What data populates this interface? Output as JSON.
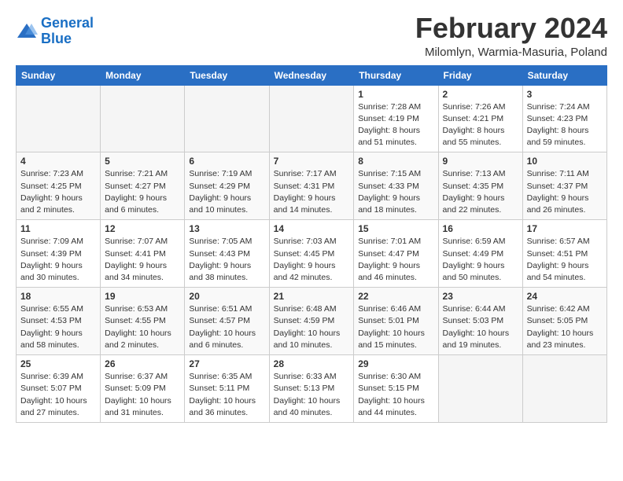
{
  "header": {
    "logo_line1": "General",
    "logo_line2": "Blue",
    "title": "February 2024",
    "subtitle": "Milomlyn, Warmia-Masuria, Poland"
  },
  "calendar": {
    "weekdays": [
      "Sunday",
      "Monday",
      "Tuesday",
      "Wednesday",
      "Thursday",
      "Friday",
      "Saturday"
    ],
    "rows": [
      [
        {
          "day": "",
          "info": ""
        },
        {
          "day": "",
          "info": ""
        },
        {
          "day": "",
          "info": ""
        },
        {
          "day": "",
          "info": ""
        },
        {
          "day": "1",
          "info": "Sunrise: 7:28 AM\nSunset: 4:19 PM\nDaylight: 8 hours\nand 51 minutes."
        },
        {
          "day": "2",
          "info": "Sunrise: 7:26 AM\nSunset: 4:21 PM\nDaylight: 8 hours\nand 55 minutes."
        },
        {
          "day": "3",
          "info": "Sunrise: 7:24 AM\nSunset: 4:23 PM\nDaylight: 8 hours\nand 59 minutes."
        }
      ],
      [
        {
          "day": "4",
          "info": "Sunrise: 7:23 AM\nSunset: 4:25 PM\nDaylight: 9 hours\nand 2 minutes."
        },
        {
          "day": "5",
          "info": "Sunrise: 7:21 AM\nSunset: 4:27 PM\nDaylight: 9 hours\nand 6 minutes."
        },
        {
          "day": "6",
          "info": "Sunrise: 7:19 AM\nSunset: 4:29 PM\nDaylight: 9 hours\nand 10 minutes."
        },
        {
          "day": "7",
          "info": "Sunrise: 7:17 AM\nSunset: 4:31 PM\nDaylight: 9 hours\nand 14 minutes."
        },
        {
          "day": "8",
          "info": "Sunrise: 7:15 AM\nSunset: 4:33 PM\nDaylight: 9 hours\nand 18 minutes."
        },
        {
          "day": "9",
          "info": "Sunrise: 7:13 AM\nSunset: 4:35 PM\nDaylight: 9 hours\nand 22 minutes."
        },
        {
          "day": "10",
          "info": "Sunrise: 7:11 AM\nSunset: 4:37 PM\nDaylight: 9 hours\nand 26 minutes."
        }
      ],
      [
        {
          "day": "11",
          "info": "Sunrise: 7:09 AM\nSunset: 4:39 PM\nDaylight: 9 hours\nand 30 minutes."
        },
        {
          "day": "12",
          "info": "Sunrise: 7:07 AM\nSunset: 4:41 PM\nDaylight: 9 hours\nand 34 minutes."
        },
        {
          "day": "13",
          "info": "Sunrise: 7:05 AM\nSunset: 4:43 PM\nDaylight: 9 hours\nand 38 minutes."
        },
        {
          "day": "14",
          "info": "Sunrise: 7:03 AM\nSunset: 4:45 PM\nDaylight: 9 hours\nand 42 minutes."
        },
        {
          "day": "15",
          "info": "Sunrise: 7:01 AM\nSunset: 4:47 PM\nDaylight: 9 hours\nand 46 minutes."
        },
        {
          "day": "16",
          "info": "Sunrise: 6:59 AM\nSunset: 4:49 PM\nDaylight: 9 hours\nand 50 minutes."
        },
        {
          "day": "17",
          "info": "Sunrise: 6:57 AM\nSunset: 4:51 PM\nDaylight: 9 hours\nand 54 minutes."
        }
      ],
      [
        {
          "day": "18",
          "info": "Sunrise: 6:55 AM\nSunset: 4:53 PM\nDaylight: 9 hours\nand 58 minutes."
        },
        {
          "day": "19",
          "info": "Sunrise: 6:53 AM\nSunset: 4:55 PM\nDaylight: 10 hours\nand 2 minutes."
        },
        {
          "day": "20",
          "info": "Sunrise: 6:51 AM\nSunset: 4:57 PM\nDaylight: 10 hours\nand 6 minutes."
        },
        {
          "day": "21",
          "info": "Sunrise: 6:48 AM\nSunset: 4:59 PM\nDaylight: 10 hours\nand 10 minutes."
        },
        {
          "day": "22",
          "info": "Sunrise: 6:46 AM\nSunset: 5:01 PM\nDaylight: 10 hours\nand 15 minutes."
        },
        {
          "day": "23",
          "info": "Sunrise: 6:44 AM\nSunset: 5:03 PM\nDaylight: 10 hours\nand 19 minutes."
        },
        {
          "day": "24",
          "info": "Sunrise: 6:42 AM\nSunset: 5:05 PM\nDaylight: 10 hours\nand 23 minutes."
        }
      ],
      [
        {
          "day": "25",
          "info": "Sunrise: 6:39 AM\nSunset: 5:07 PM\nDaylight: 10 hours\nand 27 minutes."
        },
        {
          "day": "26",
          "info": "Sunrise: 6:37 AM\nSunset: 5:09 PM\nDaylight: 10 hours\nand 31 minutes."
        },
        {
          "day": "27",
          "info": "Sunrise: 6:35 AM\nSunset: 5:11 PM\nDaylight: 10 hours\nand 36 minutes."
        },
        {
          "day": "28",
          "info": "Sunrise: 6:33 AM\nSunset: 5:13 PM\nDaylight: 10 hours\nand 40 minutes."
        },
        {
          "day": "29",
          "info": "Sunrise: 6:30 AM\nSunset: 5:15 PM\nDaylight: 10 hours\nand 44 minutes."
        },
        {
          "day": "",
          "info": ""
        },
        {
          "day": "",
          "info": ""
        }
      ]
    ]
  }
}
